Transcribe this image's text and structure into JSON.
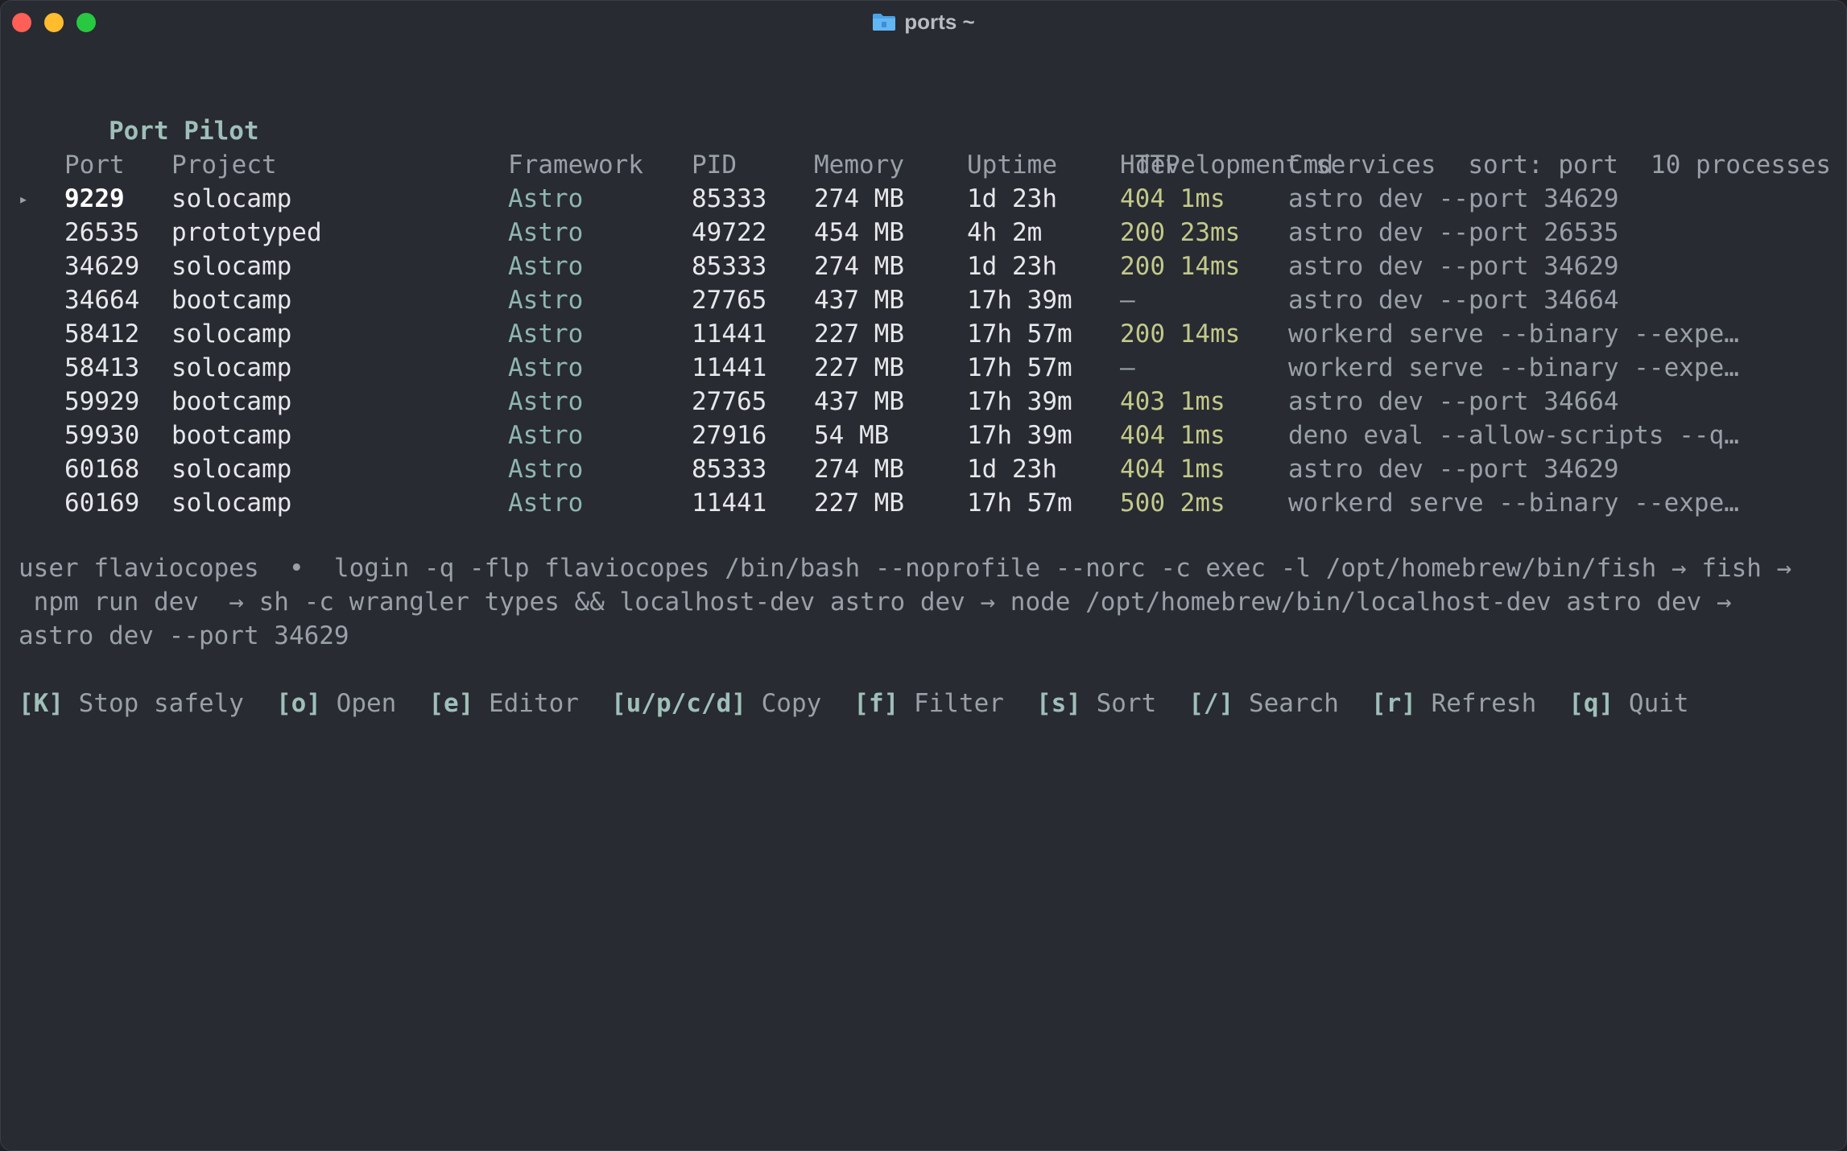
{
  "window": {
    "title": "ports ~"
  },
  "header": {
    "app_name": "Port Pilot",
    "subtitle": "development services",
    "sort": "sort: port",
    "count": "10 processes"
  },
  "table": {
    "columns": [
      "Port",
      "Project",
      "Framework",
      "PID",
      "Memory",
      "Uptime",
      "HTTP",
      "Cmd"
    ],
    "selected_marker": "▸",
    "rows": [
      {
        "port": "9229",
        "project": "solocamp",
        "framework": "Astro",
        "pid": "85333",
        "memory": "274 MB",
        "uptime": "1d 23h",
        "http": "404 1ms",
        "cmd": "astro dev --port 34629"
      },
      {
        "port": "26535",
        "project": "prototyped",
        "framework": "Astro",
        "pid": "49722",
        "memory": "454 MB",
        "uptime": "4h 2m",
        "http": "200 23ms",
        "cmd": "astro dev --port 26535"
      },
      {
        "port": "34629",
        "project": "solocamp",
        "framework": "Astro",
        "pid": "85333",
        "memory": "274 MB",
        "uptime": "1d 23h",
        "http": "200 14ms",
        "cmd": "astro dev --port 34629"
      },
      {
        "port": "34664",
        "project": "bootcamp",
        "framework": "Astro",
        "pid": "27765",
        "memory": "437 MB",
        "uptime": "17h 39m",
        "http": "—",
        "cmd": "astro dev --port 34664"
      },
      {
        "port": "58412",
        "project": "solocamp",
        "framework": "Astro",
        "pid": "11441",
        "memory": "227 MB",
        "uptime": "17h 57m",
        "http": "200 14ms",
        "cmd": "workerd serve --binary --expe…"
      },
      {
        "port": "58413",
        "project": "solocamp",
        "framework": "Astro",
        "pid": "11441",
        "memory": "227 MB",
        "uptime": "17h 57m",
        "http": "—",
        "cmd": "workerd serve --binary --expe…"
      },
      {
        "port": "59929",
        "project": "bootcamp",
        "framework": "Astro",
        "pid": "27765",
        "memory": "437 MB",
        "uptime": "17h 39m",
        "http": "403 1ms",
        "cmd": "astro dev --port 34664"
      },
      {
        "port": "59930",
        "project": "bootcamp",
        "framework": "Astro",
        "pid": "27916",
        "memory": "54 MB",
        "uptime": "17h 39m",
        "http": "404 1ms",
        "cmd": "deno eval --allow-scripts --q…"
      },
      {
        "port": "60168",
        "project": "solocamp",
        "framework": "Astro",
        "pid": "85333",
        "memory": "274 MB",
        "uptime": "1d 23h",
        "http": "404 1ms",
        "cmd": "astro dev --port 34629"
      },
      {
        "port": "60169",
        "project": "solocamp",
        "framework": "Astro",
        "pid": "11441",
        "memory": "227 MB",
        "uptime": "17h 57m",
        "http": "500 2ms",
        "cmd": "workerd serve --binary --expe…"
      }
    ]
  },
  "details": {
    "line1": "user flaviocopes  •  login -q -flp flaviocopes /bin/bash --noprofile --norc -c exec -l /opt/homebrew/bin/fish → fish →",
    "line2": " npm run dev  → sh -c wrangler types && localhost-dev astro dev → node /opt/homebrew/bin/localhost-dev astro dev →",
    "line3": "astro dev --port 34629"
  },
  "footer": [
    {
      "key": "[K]",
      "label": "Stop safely"
    },
    {
      "key": "[o]",
      "label": "Open"
    },
    {
      "key": "[e]",
      "label": "Editor"
    },
    {
      "key": "[u/p/c/d]",
      "label": "Copy"
    },
    {
      "key": "[f]",
      "label": "Filter"
    },
    {
      "key": "[s]",
      "label": "Sort"
    },
    {
      "key": "[/]",
      "label": "Search"
    },
    {
      "key": "[r]",
      "label": "Refresh"
    },
    {
      "key": "[q]",
      "label": "Quit"
    }
  ],
  "colors": {
    "background": "#282b31",
    "accent": "#9fbfba",
    "http_text": "#c2c98a",
    "dim_text": "#9aa0a8"
  }
}
